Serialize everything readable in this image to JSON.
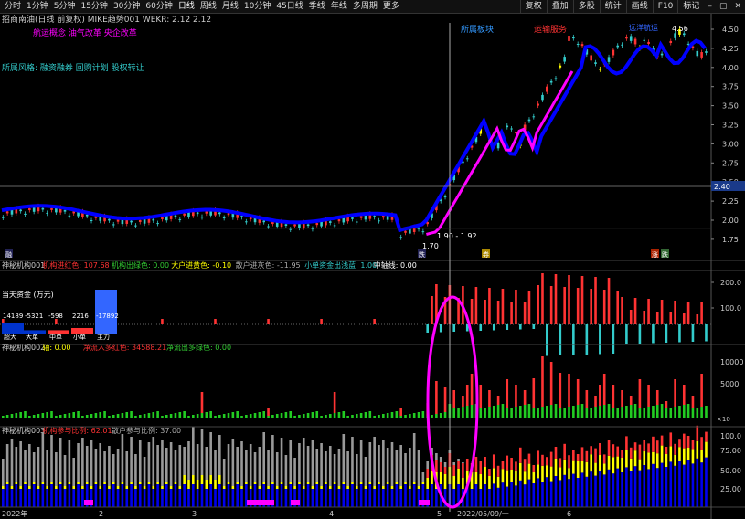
{
  "toolbar": {
    "periods": [
      "分时",
      "1分钟",
      "5分钟",
      "15分钟",
      "30分钟",
      "60分钟",
      "日线",
      "周线",
      "月线",
      "10分钟",
      "45日线",
      "季线",
      "年线",
      "多周期",
      "更多"
    ],
    "active_period": "日线",
    "right_buttons": [
      "复权",
      "叠加",
      "多股",
      "统计",
      "画线",
      "F10",
      "标记"
    ]
  },
  "main_panel": {
    "header": "招商南油(日线 前复权)  MIKE趋势001  WEKR: 2.12  2.12",
    "concepts": "航运概念  油气改革  央企改革",
    "style": "所属风格:  融资融券  回购计划  股权转让",
    "tag_zone": "所属板块",
    "tag_service": "运输服务",
    "tag_ocean": "远洋航运",
    "peak_label": "4.56",
    "low_label": "1.70",
    "cursor_label": "1.90 - 1.92",
    "price_marker": "2.40",
    "markers": [
      "融",
      "券",
      "涨",
      "跌",
      "跌"
    ],
    "y_ticks": [
      "4.50",
      "4.25",
      "4.00",
      "3.75",
      "3.50",
      "3.25",
      "3.00",
      "2.75",
      "2.50",
      "2.25",
      "2.00",
      "1.75"
    ]
  },
  "panel1": {
    "header": [
      {
        "text": "神秘机构001",
        "color": "#cccccc"
      },
      {
        "text": "机构进红色: 107.68",
        "color": "#ff3333"
      },
      {
        "text": "机构出绿色: 0.00",
        "color": "#33cc33"
      },
      {
        "text": "大户进黄色: -0.10",
        "color": "#ffff00"
      },
      {
        "text": "散户进灰色: -11.95",
        "color": "#aaaaaa"
      },
      {
        "text": "小单资金出浅蓝: 1.00",
        "color": "#33cccc"
      },
      {
        "text": "中轴线: 0.00",
        "color": "#ffffff"
      }
    ],
    "y_ticks": [
      "200.0",
      "100.0"
    ],
    "fund_box": {
      "title": "当天资金 (万元)",
      "values": [
        "14189",
        "-5321",
        "-598",
        "2216",
        "-17892"
      ],
      "labels": [
        "超大",
        "大单",
        "中单",
        "小单",
        "主力"
      ]
    }
  },
  "panel2": {
    "header": [
      {
        "text": "神秘机构002",
        "color": "#cccccc"
      },
      {
        "text": "轴: 0.00",
        "color": "#ffff00"
      },
      {
        "text": "净流入多红色: 34588.21",
        "color": "#ff3333"
      },
      {
        "text": "净流出多绿色: 0.00",
        "color": "#33cc33"
      }
    ],
    "y_ticks": [
      "10000",
      "5000"
    ],
    "unit": "×10"
  },
  "panel3": {
    "header": [
      {
        "text": "神秘机构003",
        "color": "#cccccc"
      },
      {
        "text": "机构参与比例: 62.01",
        "color": "#ff3333"
      },
      {
        "text": "散户参与比例: 37.00",
        "color": "#aaaaaa"
      }
    ],
    "y_ticks": [
      "100.0",
      "75.00",
      "50.00",
      "25.00"
    ]
  },
  "date_axis": [
    "2022年",
    "2",
    "3",
    "4",
    "5",
    "2022/05/09/一",
    "6"
  ],
  "colors": {
    "up": "#ff3333",
    "down": "#33cccc",
    "ma": "#0000ff",
    "ma_pink": "#ff00ff",
    "yellow": "#ffff00",
    "gray": "#999999",
    "green": "#22cc22",
    "blue": "#0000ee",
    "magenta": "#ff00ff"
  }
}
